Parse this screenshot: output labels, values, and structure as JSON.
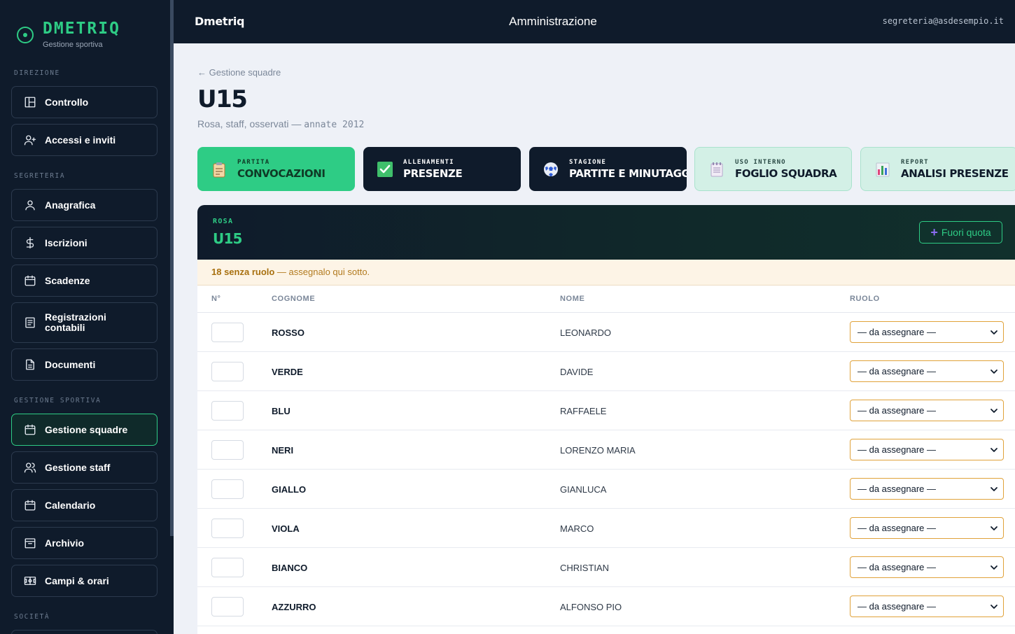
{
  "brand": {
    "name": "DMETRIQ",
    "sub": "Gestione sportiva"
  },
  "sidebar": {
    "sections": [
      {
        "label": "DIREZIONE"
      },
      {
        "label": "SEGRETERIA"
      },
      {
        "label": "GESTIONE SPORTIVA"
      },
      {
        "label": "SOCIETÀ"
      }
    ],
    "items": [
      {
        "label": "Controllo",
        "icon": "dashboard-icon"
      },
      {
        "label": "Accessi e inviti",
        "icon": "user-plus-icon"
      },
      {
        "label": "Anagrafica",
        "icon": "user-icon"
      },
      {
        "label": "Iscrizioni",
        "icon": "dollar-icon"
      },
      {
        "label": "Scadenze",
        "icon": "calendar-icon"
      },
      {
        "label": "Registrazioni contabili",
        "icon": "ledger-icon"
      },
      {
        "label": "Documenti",
        "icon": "document-icon"
      },
      {
        "label": "Gestione squadre",
        "icon": "calendar-icon",
        "active": true
      },
      {
        "label": "Gestione staff",
        "icon": "users-icon"
      },
      {
        "label": "Calendario",
        "icon": "calendar-icon"
      },
      {
        "label": "Archivio",
        "icon": "archive-icon"
      },
      {
        "label": "Campi & orari",
        "icon": "field-icon"
      }
    ]
  },
  "topbar": {
    "brand": "Dmetriq",
    "center": "Amministrazione",
    "email": "segreteria@asdesempio.it"
  },
  "main": {
    "back": "← Gestione squadre",
    "title": "U15",
    "subtitle": "Rosa, staff, osservati —",
    "subtitle_mono": "annate 2012",
    "cards": [
      {
        "small": "PARTITA",
        "big": "CONVOCAZIONI",
        "icon": "clipboard-icon",
        "style": "green"
      },
      {
        "small": "ALLENAMENTI",
        "big": "PRESENZE",
        "icon": "checkbox-icon",
        "style": "dark"
      },
      {
        "small": "STAGIONE",
        "big": "PARTITE E MINUTAGGI",
        "icon": "soccer-ball-icon",
        "style": "dark"
      },
      {
        "small": "USO INTERNO",
        "big": "FOGLIO SQUADRA",
        "icon": "notepad-icon",
        "style": "light"
      },
      {
        "small": "REPORT",
        "big": "ANALISI PRESENZE",
        "icon": "bar-chart-icon",
        "style": "light"
      }
    ],
    "roster": {
      "small": "ROSA",
      "title": "U15",
      "button": "Fuori quota",
      "warning_bold": "18 senza ruolo",
      "warning_rest": " — assegnalo qui sotto.",
      "columns": [
        "N°",
        "COGNOME",
        "NOME",
        "RUOLO"
      ],
      "rows": [
        {
          "cognome": "ROSSO",
          "nome": "LEONARDO",
          "ruolo": "— da assegnare —"
        },
        {
          "cognome": "VERDE",
          "nome": "DAVIDE",
          "ruolo": "— da assegnare —"
        },
        {
          "cognome": "BLU",
          "nome": "RAFFAELE",
          "ruolo": "— da assegnare —"
        },
        {
          "cognome": "NERI",
          "nome": "LORENZO MARIA",
          "ruolo": "— da assegnare —"
        },
        {
          "cognome": "GIALLO",
          "nome": "GIANLUCA",
          "ruolo": "— da assegnare —"
        },
        {
          "cognome": "VIOLA",
          "nome": "MARCO",
          "ruolo": "— da assegnare —"
        },
        {
          "cognome": "BIANCO",
          "nome": "CHRISTIAN",
          "ruolo": "— da assegnare —"
        },
        {
          "cognome": "AZZURRO",
          "nome": "ALFONSO PIO",
          "ruolo": "— da assegnare —"
        }
      ]
    }
  },
  "colors": {
    "accent": "#2ecc85",
    "dark": "#0f1b2b",
    "warning": "#e0a23a"
  }
}
